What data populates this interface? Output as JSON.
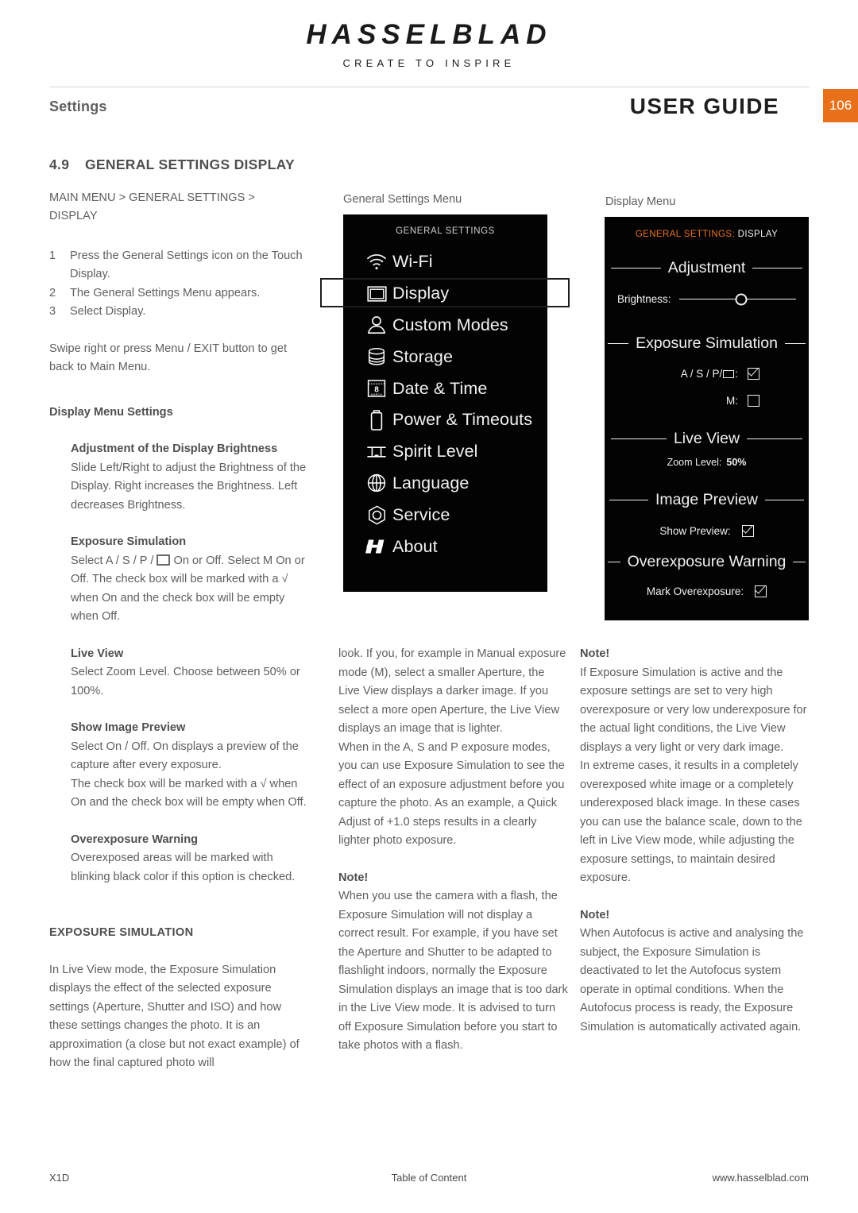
{
  "brand": {
    "name": "HASSELBLAD",
    "tagline": "CREATE TO INSPIRE"
  },
  "header": {
    "section_label": "Settings",
    "doc_title": "USER GUIDE",
    "page_number": "106"
  },
  "section": {
    "number": "4.9",
    "title": "GENERAL SETTINGS DISPLAY",
    "breadcrumb_line1": "MAIN MENU > GENERAL SETTINGS >",
    "breadcrumb_line2": "DISPLAY",
    "steps": [
      {
        "n": "1",
        "text": "Press the General Settings icon on the Touch Display."
      },
      {
        "n": "2",
        "text": "The General Settings Menu appears."
      },
      {
        "n": "3",
        "text": "Select Display."
      }
    ],
    "back_note": "Swipe right or press Menu / EXIT button to get back to Main Menu."
  },
  "display_menu_settings": {
    "heading": "Display Menu Settings",
    "entries": [
      {
        "title": "Adjustment of the Display Brightness",
        "body": "Slide Left/Right to adjust the Brightness of the Display. Right increases the Brightness. Left decreases Brightness."
      },
      {
        "title": "Exposure Simulation",
        "body_before_box": "Select A / S / P /",
        "body_after_box": "On or Off. Select M On or Off. The check box will be marked with a √ when On and the check box will be empty when Off."
      },
      {
        "title": "Live View",
        "body": "Select Zoom Level. Choose between 50% or 100%."
      },
      {
        "title": "Show Image Preview",
        "body": "Select On / Off. On displays a preview  of the capture after every exposure.\nThe check box will be marked with a √ when On and the check box will be empty when Off."
      },
      {
        "title": "Overexposure Warning",
        "body": "Overexposed areas will be marked with blinking black color if this option is checked."
      }
    ]
  },
  "exposure_simulation": {
    "heading": "EXPOSURE SIMULATION",
    "para1": "In Live View mode, the Exposure Simulation displays the effect of the selected exposure settings (Aperture, Shutter and ISO) and how these settings changes the photo. It is an approximation (a close but not exact example) of how the final captured photo will",
    "para2": "look. If you, for example in Manual exposure mode (M), select a smaller Aperture, the Live View displays a darker image. If you select a more open Aperture, the Live View displays an image that is lighter.",
    "para3": "When in the A, S and P exposure modes, you can use Exposure Simulation to see the effect of an exposure adjustment before you capture the photo. As an example, a Quick Adjust of +1.0 steps results in a clearly lighter photo exposure.",
    "note_label": "Note!",
    "note_flash": "When you use the camera with a flash, the Exposure Simulation will not display a correct result. For example, if you have set the Aperture and Shutter to be adapted to flashlight indoors, normally the Exposure Simulation displays an image that is too dark in the Live View mode. It is advised to turn off Exposure Simulation before you start to take photos with a flash."
  },
  "right_notes": {
    "note1_label": "Note!",
    "note1_body": "If Exposure Simulation is active and the exposure settings are set to very high overexposure or very low underexposure for the actual light conditions, the Live View displays a very light or very dark image.\nIn extreme cases, it results in a completely overexposed white image or a completely underexposed black image. In these cases you can use the balance scale, down to the left in Live View mode, while adjusting the exposure settings, to maintain desired exposure.",
    "note2_label": "Note!",
    "note2_body": "When Autofocus is active and analysing the subject, the Exposure Simulation is deactivated to let the Autofocus system operate in optimal conditions. When the Autofocus process is ready, the Exposure Simulation is automatically activated again."
  },
  "general_settings_figure": {
    "caption": "General Settings Menu",
    "screen_title": "GENERAL SETTINGS",
    "items": [
      {
        "label": "Wi-Fi",
        "icon": "wifi-icon",
        "selected": false
      },
      {
        "label": "Display",
        "icon": "display-icon",
        "selected": true
      },
      {
        "label": "Custom Modes",
        "icon": "person-icon",
        "selected": false
      },
      {
        "label": "Storage",
        "icon": "database-icon",
        "selected": false
      },
      {
        "label": "Date & Time",
        "icon": "calendar-icon",
        "selected": false
      },
      {
        "label": "Power & Timeouts",
        "icon": "battery-icon",
        "selected": false
      },
      {
        "label": "Spirit Level",
        "icon": "spirit-level-icon",
        "selected": false
      },
      {
        "label": "Language",
        "icon": "globe-icon",
        "selected": false
      },
      {
        "label": "Service",
        "icon": "hex-gear-icon",
        "selected": false
      },
      {
        "label": "About",
        "icon": "hasselblad-h-icon",
        "selected": false
      }
    ]
  },
  "display_menu_figure": {
    "caption": "Display Menu",
    "title_orange": "GENERAL SETTINGS:",
    "title_white": "DISPLAY",
    "groups": [
      {
        "name": "Adjustment"
      },
      {
        "name": "Exposure Simulation"
      },
      {
        "name": "Live View"
      },
      {
        "name": "Image Preview"
      },
      {
        "name": "Overexposure Warning"
      }
    ],
    "brightness_label": "Brightness:",
    "brightness_value": 53,
    "aspm_label": "A / S / P/",
    "aspm_colon": ":",
    "aspm_checked": true,
    "m_label": "M:",
    "m_checked": false,
    "zoom_label": "Zoom Level:",
    "zoom_value": "50%",
    "show_preview_label": "Show Preview:",
    "show_preview_checked": true,
    "mark_overexposure_label": "Mark Overexposure:",
    "mark_overexposure_checked": true
  },
  "footer": {
    "left": "X1D",
    "center": "Table of Content",
    "right": "www.hasselblad.com"
  },
  "colors": {
    "accent_orange": "#e8701a",
    "screen_black": "#030303",
    "body_text": "#5f5f5f"
  }
}
